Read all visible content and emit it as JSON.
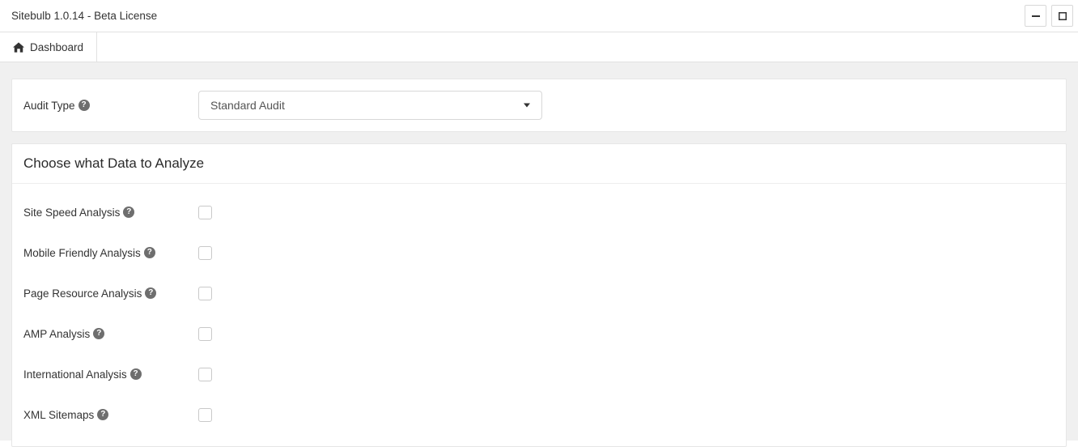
{
  "app_title": "Sitebulb 1.0.14  - Beta License",
  "nav": {
    "dashboard_label": "Dashboard"
  },
  "audit": {
    "label": "Audit Type",
    "selected": "Standard Audit"
  },
  "analyze": {
    "heading": "Choose what Data to Analyze",
    "options": [
      {
        "label": "Site Speed Analysis"
      },
      {
        "label": "Mobile Friendly Analysis"
      },
      {
        "label": "Page Resource Analysis"
      },
      {
        "label": "AMP Analysis"
      },
      {
        "label": "International Analysis"
      },
      {
        "label": "XML Sitemaps"
      }
    ]
  }
}
